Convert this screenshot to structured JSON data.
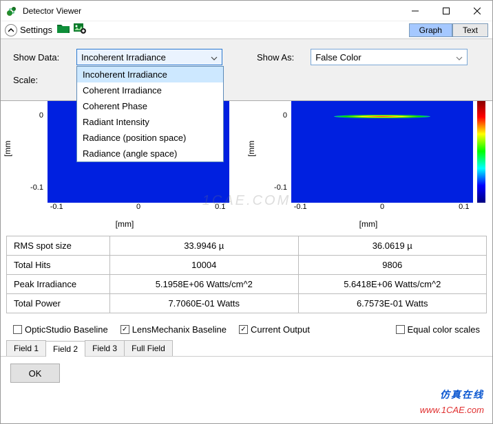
{
  "title": "Detector Viewer",
  "settings_label": "Settings",
  "right_tabs": {
    "graph": "Graph",
    "text": "Text"
  },
  "controls": {
    "show_data_label": "Show Data:",
    "show_data_value": "Incoherent Irradiance",
    "show_data_options": [
      "Incoherent Irradiance",
      "Coherent Irradiance",
      "Coherent Phase",
      "Radiant Intensity",
      "Radiance (position space)",
      "Radiance (angle space)"
    ],
    "show_as_label": "Show As:",
    "show_as_value": "False Color",
    "scale_label": "Scale:"
  },
  "plot": {
    "x_ticks": [
      "-0.1",
      "0",
      "0.1"
    ],
    "y_ticks": [
      "0",
      "-0.1"
    ],
    "x_label": "[mm]",
    "y_label": "[mm"
  },
  "table": {
    "rows": [
      {
        "name": "RMS spot size",
        "v1": "33.9946 µ",
        "v2": "36.0619 µ"
      },
      {
        "name": "Total Hits",
        "v1": "10004",
        "v2": "9806"
      },
      {
        "name": "Peak Irradiance",
        "v1": "5.1958E+06 Watts/cm^2",
        "v2": "5.6418E+06 Watts/cm^2"
      },
      {
        "name": "Total Power",
        "v1": "7.7060E-01 Watts",
        "v2": "6.7573E-01 Watts"
      }
    ]
  },
  "checks": {
    "optic": "OpticStudio Baseline",
    "lens": "LensMechanix Baseline",
    "current": "Current Output",
    "equal": "Equal color scales"
  },
  "field_tabs": [
    "Field 1",
    "Field 2",
    "Field 3",
    "Full Field"
  ],
  "ok_label": "OK",
  "watermark1": "仿真在线",
  "watermark2": "www.1CAE.com",
  "center_watermark": "1CAE.COM",
  "chart_data": [
    {
      "type": "heatmap",
      "title": "",
      "xlabel": "[mm]",
      "ylabel": "[mm]",
      "xlim": [
        -0.1,
        0.1
      ],
      "ylim": [
        -0.1,
        0.1
      ],
      "note": "Incoherent irradiance false-color map, bright elongated spot near y≈0",
      "peak_y": 0,
      "colormap": "jet"
    },
    {
      "type": "heatmap",
      "title": "",
      "xlabel": "[mm]",
      "ylabel": "[mm]",
      "xlim": [
        -0.1,
        0.1
      ],
      "ylim": [
        -0.1,
        0.1
      ],
      "note": "Incoherent irradiance false-color map, thin horizontal bright line near y≈0",
      "peak_y": 0,
      "colormap": "jet"
    }
  ]
}
